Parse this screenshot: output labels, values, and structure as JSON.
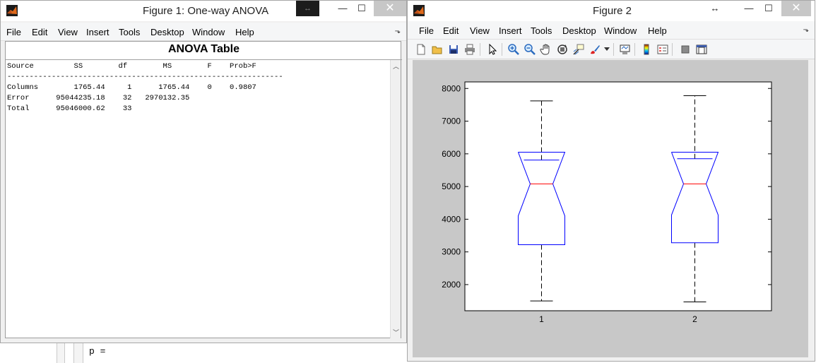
{
  "fig1": {
    "title": "Figure 1: One-way ANOVA",
    "menu": [
      "File",
      "Edit",
      "View",
      "Insert",
      "Tools",
      "Desktop",
      "Window",
      "Help"
    ],
    "table_title": "ANOVA Table",
    "header": "Source         SS        df        MS        F    Prob>F",
    "divider": "--------------------------------------------------------------",
    "rows": [
      "Columns        1765.44     1      1765.44    0    0.9807",
      "Error      95044235.18    32   2970132.35",
      "Total      95046000.62    33"
    ]
  },
  "fig2": {
    "title": "Figure 2",
    "menu": [
      "File",
      "Edit",
      "View",
      "Insert",
      "Tools",
      "Desktop",
      "Window",
      "Help"
    ],
    "toolbar": [
      "new-figure-icon",
      "open-file-icon",
      "save-icon",
      "print-icon",
      "edit-plot-arrow-icon",
      "zoom-in-icon",
      "zoom-out-icon",
      "pan-hand-icon",
      "rotate-3d-icon",
      "data-cursor-icon",
      "brush-icon",
      "link-plot-icon",
      "colorbar-icon",
      "legend-icon",
      "hide-plot-tools-icon",
      "show-plot-tools-icon"
    ]
  },
  "command_window": {
    "text": "p ="
  },
  "chart_data": {
    "type": "boxplot",
    "notched": true,
    "categories": [
      "1",
      "2"
    ],
    "ylim": [
      1200,
      8200
    ],
    "yticks": [
      2000,
      3000,
      4000,
      5000,
      6000,
      7000,
      8000
    ],
    "boxes": [
      {
        "category": "1",
        "lower_whisker": 1500,
        "q1": 3220,
        "median": 5080,
        "q3": 5810,
        "upper_whisker": 7620,
        "notch_low": 4100,
        "notch_high": 6050
      },
      {
        "category": "2",
        "lower_whisker": 1470,
        "q1": 3280,
        "median": 5080,
        "q3": 5850,
        "upper_whisker": 7780,
        "notch_low": 4130,
        "notch_high": 6050
      }
    ],
    "colors": {
      "box": "#0000ff",
      "median": "#ff0000",
      "whisker": "#000000"
    },
    "grid": false
  }
}
